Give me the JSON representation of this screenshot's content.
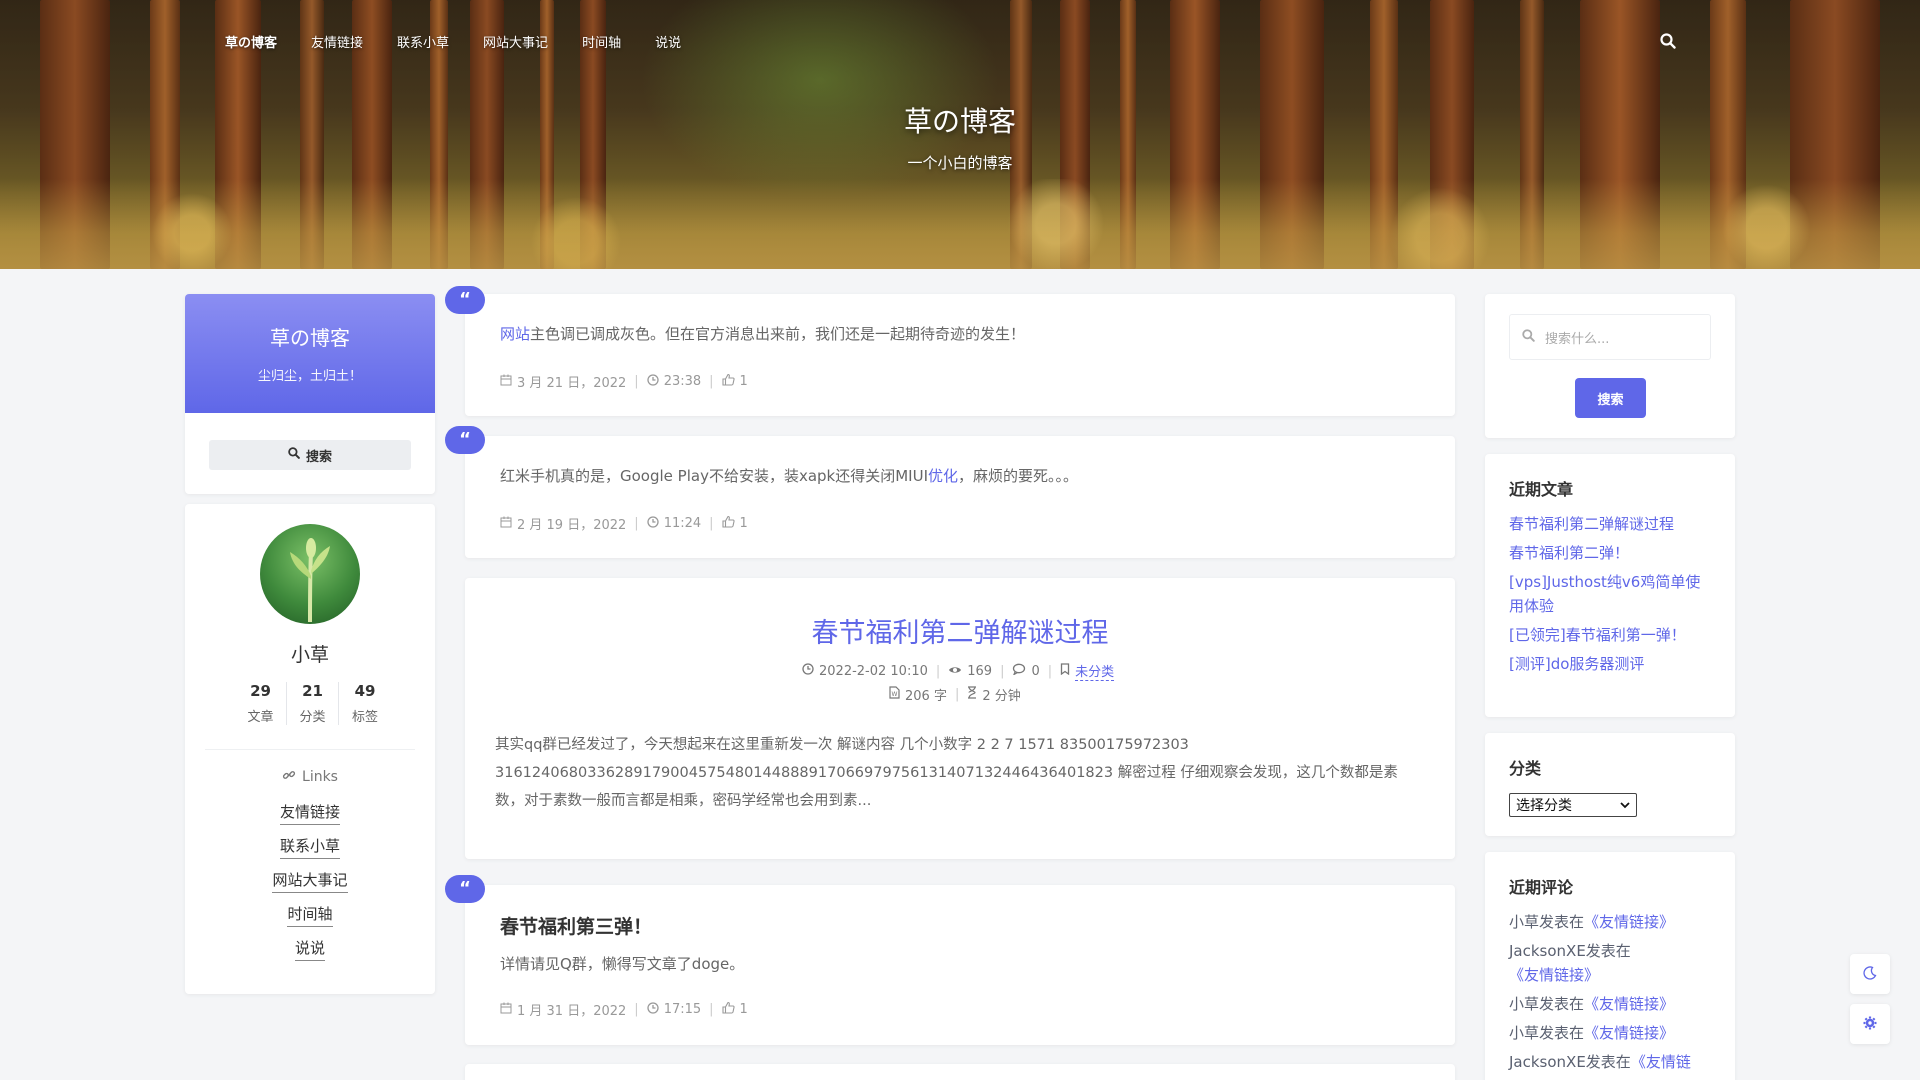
{
  "nav": {
    "items": [
      "草の博客",
      "友情链接",
      "联系小草",
      "网站大事记",
      "时间轴",
      "说说"
    ]
  },
  "header": {
    "title": "草の博客",
    "subtitle": "一个小白的博客"
  },
  "profile": {
    "title": "草の博客",
    "motto": "尘归尘，土归土！",
    "search_label": "搜索",
    "name": "小草",
    "stats": [
      {
        "num": "29",
        "label": "文章"
      },
      {
        "num": "21",
        "label": "分类"
      },
      {
        "num": "49",
        "label": "标签"
      }
    ],
    "links_title": "Links",
    "links": [
      "友情链接",
      "联系小草",
      "网站大事记",
      "时间轴",
      "说说"
    ]
  },
  "posts": {
    "p1": {
      "badge": "“",
      "highlight": "网站",
      "text": "主色调已调成灰色。但在官方消息出来前，我们还是一起期待奇迹的发生！",
      "date": "3 月 21 日，2022",
      "time": "23:38",
      "likes": "1"
    },
    "p2": {
      "badge": "“",
      "text_a": "红米手机真的是，Google Play不给安装，装xapk还得关闭MIUI",
      "highlight": "优化",
      "text_b": "，麻烦的要死。。。",
      "date": "2 月 19 日，2022",
      "time": "11:24",
      "likes": "1"
    },
    "p3": {
      "title": "春节福利第二弹解谜过程",
      "datetime": "2022-2-02 10:10",
      "views": "169",
      "comments": "0",
      "category": "未分类",
      "words": "206 字",
      "read_time": "2 分钟",
      "excerpt": "其实qq群已经发过了，今天想起来在这里重新发一次 解谜内容 几个小数字 2 2 7 1571 83500175972303 316124068033628917900457548014488891706697975613140713244643640182​3 解密过程 仔细观察会发现，这几个数都是素数，对于素数一般而言都是相乘，密码学经常也会用到素..."
    },
    "p4": {
      "badge": "“",
      "title": "春节福利第三弹！",
      "text": "详情请见Q群，懒得写文章了doge。",
      "date": "1 月 31 日，2022",
      "time": "17:15",
      "likes": "1"
    }
  },
  "sidebar": {
    "search_placeholder": "搜索什么...",
    "search_button": "搜索",
    "recent_title": "近期文章",
    "recent": [
      "春节福利第二弹解谜过程",
      "春节福利第二弹！",
      "[vps]Justhost纯v6鸡简单使用体验",
      "[已领完]春节福利第一弹！",
      "[测评]do服务器测评"
    ],
    "category_title": "分类",
    "category_select": "选择分类",
    "comments_title": "近期评论",
    "comments": [
      {
        "who": "小草发表在",
        "link": "《友情链接》"
      },
      {
        "who": "JacksonXE发表在",
        "link": "《友情链接》"
      },
      {
        "who": "小草发表在",
        "link": "《友情链接》"
      },
      {
        "who": "小草发表在",
        "link": "《友情链接》"
      },
      {
        "who": "JacksonXE发表在",
        "link": "《友情链"
      }
    ]
  },
  "colors": {
    "accent": "#5f67e8",
    "background": "#f4f5f7"
  },
  "icons": [
    "search-icon",
    "quote-icon",
    "calendar-icon",
    "clock-icon",
    "thumb-up-icon",
    "eye-icon",
    "comment-icon",
    "bookmark-icon",
    "file-icon",
    "hourglass-icon",
    "link-icon",
    "moon-icon",
    "gear-icon"
  ]
}
